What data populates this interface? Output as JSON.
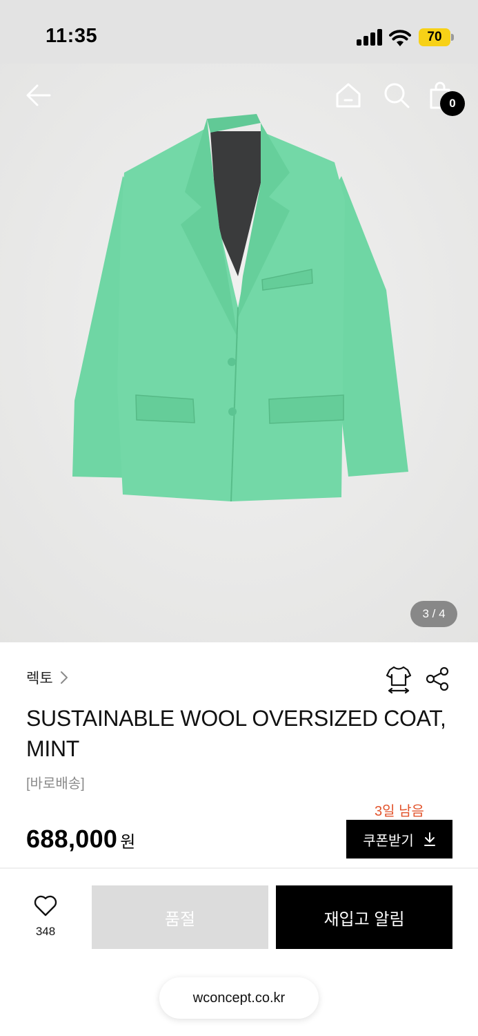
{
  "status_bar": {
    "time": "11:35",
    "battery": "70",
    "battery_color": "#f7d117"
  },
  "header": {
    "icons": [
      "back-arrow-icon",
      "home-icon",
      "search-icon",
      "shopping-bag-icon"
    ],
    "cart_count": "0"
  },
  "gallery": {
    "counter": "3 / 4",
    "product_color": "#6fd6a4"
  },
  "product": {
    "brand": "렉토",
    "title": "SUSTAINABLE WOOL OVERSIZED COAT, MINT",
    "delivery_tag": "[바로배송]",
    "days_left": "3일 남음",
    "days_left_color": "#e2532b",
    "price": "688,000",
    "currency": "원"
  },
  "actions": {
    "coupon_label": "쿠폰받기",
    "wish_count": "348",
    "soldout_label": "품절",
    "restock_label": "재입고 알림"
  },
  "browser": {
    "url": "wconcept.co.kr"
  }
}
